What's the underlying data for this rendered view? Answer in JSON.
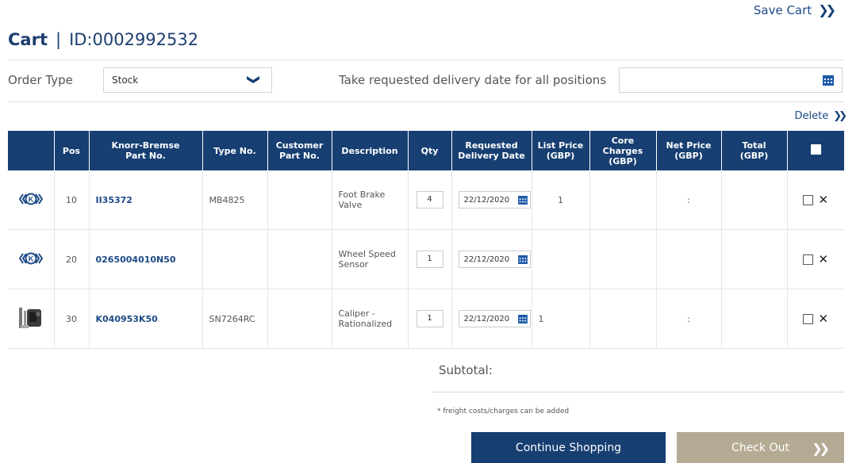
{
  "header": {
    "save_cart_label": "Save Cart",
    "cart_word": "Cart",
    "separator": "|",
    "cart_id": "ID:0002992532"
  },
  "order_row": {
    "order_type_label": "Order Type",
    "order_type_value": "Stock",
    "delivery_all_label": "Take requested delivery date for all positions",
    "delivery_all_value": ""
  },
  "delete_label": "Delete",
  "table": {
    "headers": {
      "pos": "Pos",
      "part_no_line1": "Knorr-Bremse",
      "part_no_line2": "Part No.",
      "type_no": "Type No.",
      "customer_line1": "Customer",
      "customer_line2": "Part No.",
      "description": "Description",
      "qty": "Qty",
      "req_line1": "Requested",
      "req_line2": "Delivery Date",
      "list_line1": "List Price",
      "list_line2": "(GBP)",
      "core_line1": "Core Charges",
      "core_line2": "(GBP)",
      "net_line1": "Net Price",
      "net_line2": "(GBP)",
      "total_line1": "Total",
      "total_line2": "(GBP)"
    },
    "rows": [
      {
        "logo": "knorr-bremse-logo-icon",
        "pos": "10",
        "part_no": "II35372",
        "type_no": "MB4825",
        "customer_part": "",
        "description": "Foot Brake Valve",
        "qty": "4",
        "delivery_date": "22/12/2020",
        "list_price": "1",
        "core_charges": "",
        "net_price": ":",
        "total": ""
      },
      {
        "logo": "knorr-bremse-logo-icon",
        "pos": "20",
        "part_no": "0265004010N50",
        "type_no": "",
        "customer_part": "",
        "description": "Wheel Speed Sensor",
        "qty": "1",
        "delivery_date": "22/12/2020",
        "list_price": "",
        "core_charges": "",
        "net_price": "",
        "total": ""
      },
      {
        "logo": "caliper-product-image",
        "pos": "30",
        "part_no": "K040953K50",
        "type_no": "SN7264RC",
        "customer_part": "",
        "description": "Caliper - Rationalized",
        "qty": "1",
        "delivery_date": "22/12/2020",
        "list_price": "1",
        "core_charges": "",
        "net_price": ":",
        "total": ""
      }
    ]
  },
  "summary": {
    "subtotal_label": "Subtotal:",
    "freight_note": "* freight costs/charges can be added"
  },
  "buttons": {
    "continue_shopping": "Continue Shopping",
    "check_out": "Check Out"
  },
  "colors": {
    "header_blue": "#173f72",
    "link_blue": "#1d4a86",
    "checkout_tan": "#b5ab94"
  }
}
